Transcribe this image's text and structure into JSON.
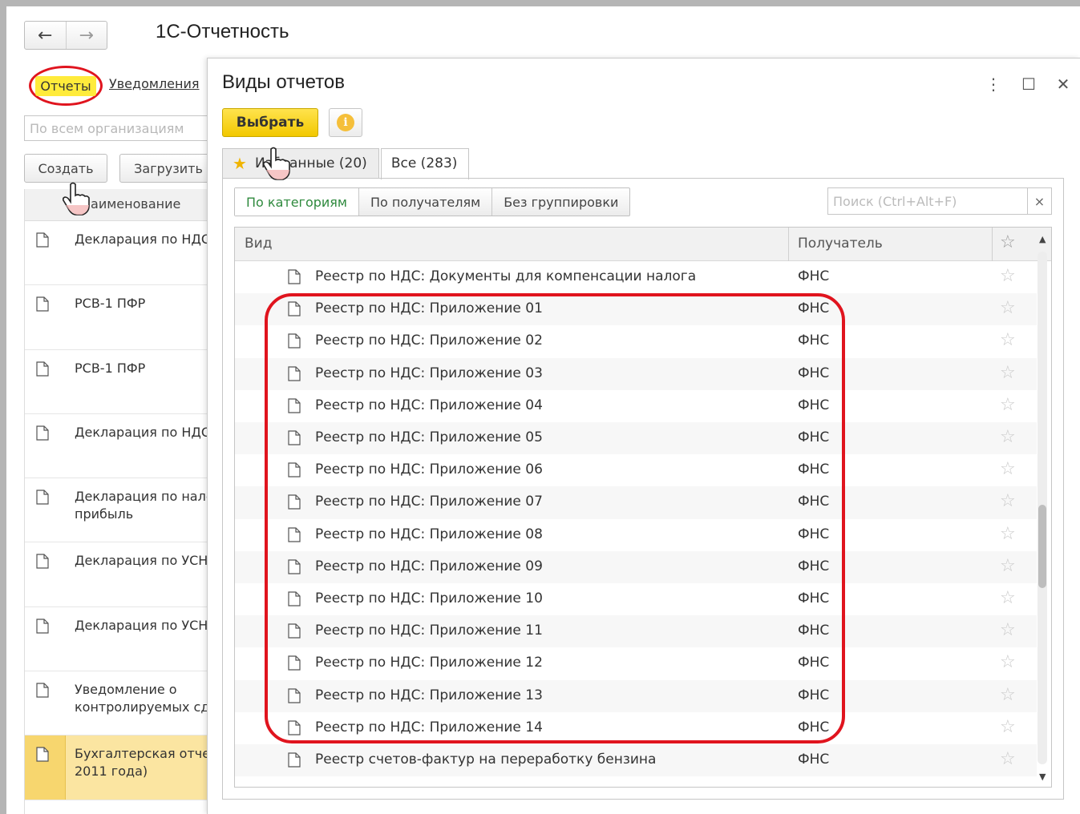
{
  "app": {
    "title": "1С-Отчетность",
    "back_icon": "←",
    "forward_icon": "→"
  },
  "bg": {
    "tabs": {
      "reports": "Отчеты",
      "notifications": "Уведомления"
    },
    "org_placeholder": "По всем организациям",
    "create_label": "Создать",
    "load_label": "Загрузить",
    "column_header": "Наименование",
    "rows": [
      {
        "line1": "Декларация по НДС",
        "line2": ""
      },
      {
        "line1": "РСВ-1 ПФР",
        "line2": ""
      },
      {
        "line1": "РСВ-1 ПФР",
        "line2": ""
      },
      {
        "line1": "Декларация по НДС",
        "line2": ""
      },
      {
        "line1": "Декларация по нало",
        "line2": "прибыль"
      },
      {
        "line1": "Декларация по УСН",
        "line2": ""
      },
      {
        "line1": "Декларация по УСН",
        "line2": ""
      },
      {
        "line1": "Уведомление о",
        "line2": "контролируемых сд"
      },
      {
        "line1": "Бухгалтерская отче",
        "line2": "2011 года)"
      }
    ]
  },
  "modal": {
    "title": "Виды отчетов",
    "menu_icon": "⋮",
    "maximize_icon": "☐",
    "close_icon": "✕",
    "select_label": "Выбрать",
    "info_icon": "i",
    "tabs": {
      "favorites": "Избранные (20)",
      "all": "Все (283)"
    },
    "groupings": [
      "По категориям",
      "По получателям",
      "Без группировки"
    ],
    "search_placeholder": "Поиск (Ctrl+Alt+F)",
    "search_clear": "×",
    "columns": {
      "kind": "Вид",
      "recipient": "Получатель"
    },
    "rows": [
      {
        "name": "Реестр по НДС: Документы для компенсации налога",
        "recipient": "ФНС"
      },
      {
        "name": "Реестр по НДС: Приложение 01",
        "recipient": "ФНС"
      },
      {
        "name": "Реестр по НДС: Приложение 02",
        "recipient": "ФНС"
      },
      {
        "name": "Реестр по НДС: Приложение 03",
        "recipient": "ФНС"
      },
      {
        "name": "Реестр по НДС: Приложение 04",
        "recipient": "ФНС"
      },
      {
        "name": "Реестр по НДС: Приложение 05",
        "recipient": "ФНС"
      },
      {
        "name": "Реестр по НДС: Приложение 06",
        "recipient": "ФНС"
      },
      {
        "name": "Реестр по НДС: Приложение 07",
        "recipient": "ФНС"
      },
      {
        "name": "Реестр по НДС: Приложение 08",
        "recipient": "ФНС"
      },
      {
        "name": "Реестр по НДС: Приложение 09",
        "recipient": "ФНС"
      },
      {
        "name": "Реестр по НДС: Приложение 10",
        "recipient": "ФНС"
      },
      {
        "name": "Реестр по НДС: Приложение 11",
        "recipient": "ФНС"
      },
      {
        "name": "Реестр по НДС: Приложение 12",
        "recipient": "ФНС"
      },
      {
        "name": "Реестр по НДС: Приложение 13",
        "recipient": "ФНС"
      },
      {
        "name": "Реестр по НДС: Приложение 14",
        "recipient": "ФНС"
      },
      {
        "name": "Реестр счетов-фактур на переработку бензина",
        "recipient": "ФНС"
      }
    ]
  },
  "colors": {
    "highlight_red": "#e0141e",
    "select_yellow": "#f2c800",
    "active_group_green": "#2f8a3e"
  }
}
